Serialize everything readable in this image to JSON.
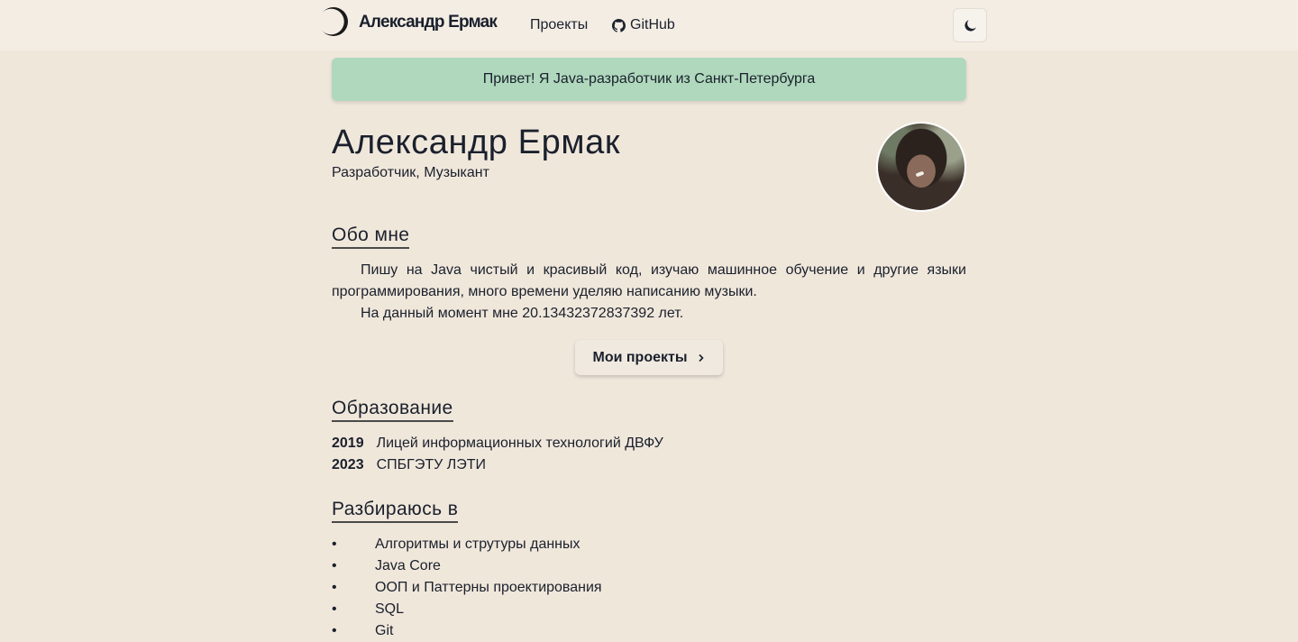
{
  "nav": {
    "logo_text": "Александр Ермак",
    "projects_link": "Проекты",
    "github_link": "GitHub",
    "theme_toggle_icon": "moon-icon"
  },
  "greeting": "Привет! Я Java-разработчик из Санкт-Петербурга",
  "profile": {
    "name": "Александр Ермак",
    "subtitle": "Разработчик, Музыкант"
  },
  "about": {
    "heading": "Обо мне",
    "paragraph_1": "Пишу на Java чистый и красивый код, изучаю машинное обучение и другие языки программирования, много времени уделяю написанию музыки.",
    "paragraph_2": "На данный момент мне 20.13432372837392 лет.",
    "projects_button": "Мои проекты"
  },
  "education": {
    "heading": "Образование",
    "items": [
      {
        "year": "2019",
        "place": "Лицей информационных технологий ДВФУ"
      },
      {
        "year": "2023",
        "place": "СПБГЭТУ ЛЭТИ"
      }
    ]
  },
  "skills": {
    "heading": "Разбираюсь в",
    "bullet": "•",
    "items": [
      "Алгоритмы и струтуры данных",
      "Java Core",
      "ООП и Паттерны проектирования",
      "SQL",
      "Git"
    ]
  },
  "colors": {
    "background": "#f0e7db",
    "greeting_bg": "#afd8bd",
    "text": "#1a202c"
  }
}
